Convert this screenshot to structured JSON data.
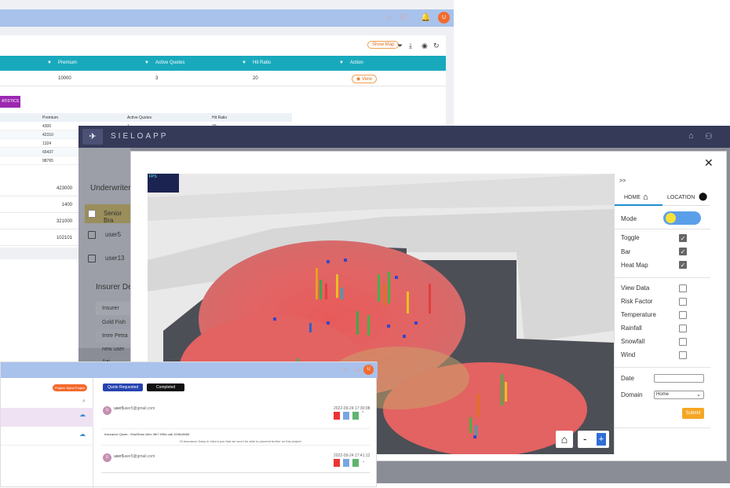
{
  "back_window": {
    "show_map_label": "Show Map",
    "table_headers": [
      "Premium",
      "Active Quotes",
      "Hit Ratio",
      "Action"
    ],
    "row": {
      "premium": "10000",
      "active_quotes": "3",
      "hit_ratio": "20",
      "action": "View"
    },
    "statistics_button": "ATISTICS",
    "sub_headers": [
      "Premium",
      "Active Quotes",
      "Hit Ratio"
    ],
    "sub_rows": [
      {
        "premium": "4300",
        "quotes": "1",
        "ratio": "20"
      },
      {
        "premium": "42310",
        "quotes": "",
        "ratio": ""
      },
      {
        "premium": "1324",
        "quotes": "",
        "ratio": ""
      },
      {
        "premium": "65437",
        "quotes": "",
        "ratio": ""
      },
      {
        "premium": "98765",
        "quotes": "",
        "ratio": ""
      }
    ],
    "side_values": [
      "423000",
      "1400",
      "321000",
      "102101"
    ],
    "user_initial": "U"
  },
  "app": {
    "logo": "SIELOAPP",
    "underwriters_title": "Underwriter",
    "underwriters": [
      "Senior Bra",
      "user5",
      "user13"
    ],
    "insurer_title": "Insurer De",
    "insurer_header": "Insurer",
    "insurers": [
      "Gold Fish",
      "Imre Petra",
      "new user",
      "Aai"
    ]
  },
  "modal": {
    "close_label": "✕",
    "fps_label": "FPS",
    "expand_label": ">>",
    "tabs": [
      {
        "label": "HOME",
        "icon": "home-icon"
      },
      {
        "label": "LOCATION",
        "icon": "pin-icon"
      }
    ],
    "mode_label": "Mode",
    "layers": [
      {
        "label": "Toggle",
        "checked": true
      },
      {
        "label": "Bar",
        "checked": true
      },
      {
        "label": "Heat Map",
        "checked": true
      }
    ],
    "data_options": [
      {
        "label": "View Data",
        "checked": false
      },
      {
        "label": "Risk Factor",
        "checked": false
      },
      {
        "label": "Temperature",
        "checked": false
      },
      {
        "label": "Rainfall",
        "checked": false
      },
      {
        "label": "Snowfall",
        "checked": false
      },
      {
        "label": "Wind",
        "checked": false
      }
    ],
    "date_label": "Date",
    "date_value": "",
    "domain_label": "Domain",
    "domain_value": "Home",
    "submit_label": "Submit",
    "zoom_out": "-",
    "zoom_in": "+"
  },
  "front_window": {
    "project_badge": "Project: Alpha Project",
    "steps": [
      "Quote Requested",
      "Completed"
    ],
    "user1": {
      "name": "user5",
      "email": "user5@gmail.com",
      "date": "2022-09-24 17:30:08"
    },
    "quote_line": "Insurance Quote - 93a29caa 1ebc 4fe7-935a cab 324618066",
    "quote_note": "Hi Insurance Dairy to Inform you that we won't be able to proceed further on this project",
    "user2": {
      "name": "user5",
      "email": "user5@gmail.com",
      "date": "2022-09-24 17:41:12"
    },
    "user_initial": "U"
  },
  "colors": {
    "accent": "#19a9bd",
    "nav": "#353a59",
    "topbar": "#a8c2ec",
    "submit": "#f5a623",
    "stats": "#9c27b0"
  }
}
